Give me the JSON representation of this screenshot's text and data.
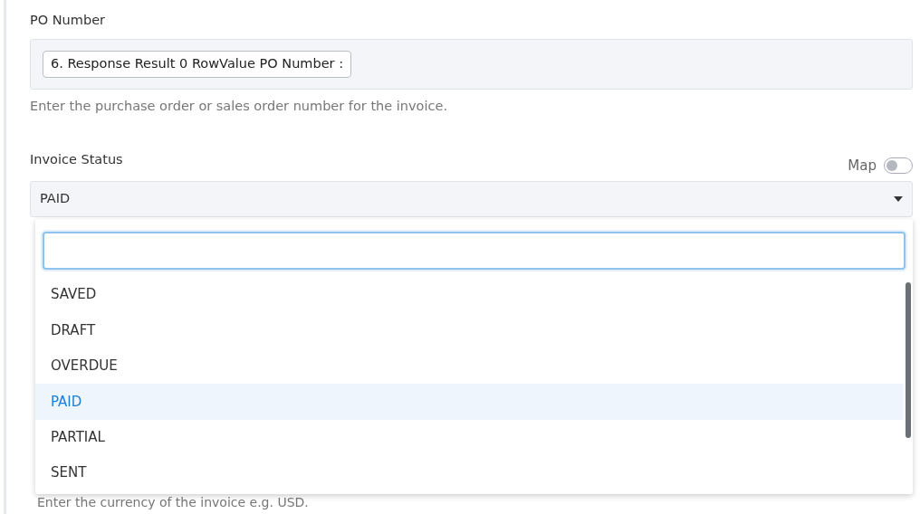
{
  "po_number": {
    "label": "PO Number",
    "value": "6. Response Result 0 RowValue PO Number :",
    "help": "Enter the purchase order or sales order number for the invoice."
  },
  "invoice_status": {
    "label": "Invoice Status",
    "map": {
      "label": "Map",
      "on": false
    },
    "value": "PAID",
    "dropdown": {
      "search": {
        "focused": true
      },
      "options": [
        {
          "label": "SAVED",
          "selected": false
        },
        {
          "label": "DRAFT",
          "selected": false
        },
        {
          "label": "OVERDUE",
          "selected": false
        },
        {
          "label": "PAID",
          "selected": true
        },
        {
          "label": "PARTIAL",
          "selected": false
        },
        {
          "label": "SENT",
          "selected": false
        }
      ]
    }
  },
  "currency": {
    "help": "Enter the currency of the invoice e.g. USD."
  }
}
